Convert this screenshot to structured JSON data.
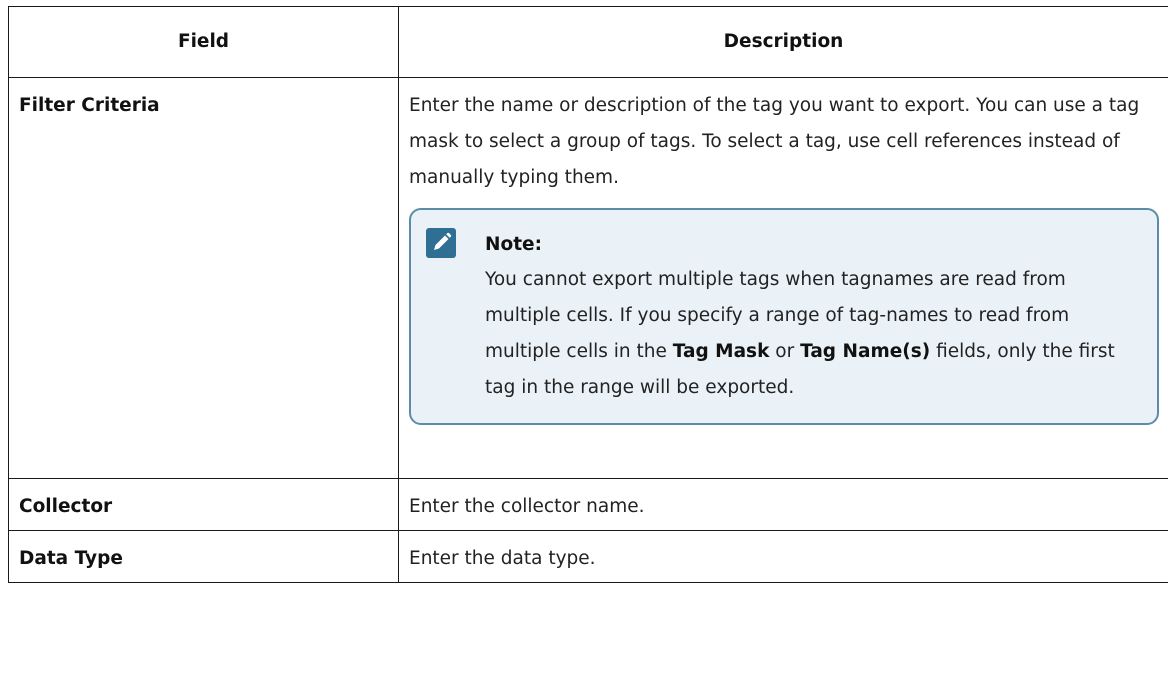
{
  "table": {
    "headers": {
      "field": "Field",
      "description": "Description"
    },
    "rows": [
      {
        "field": "Filter Criteria",
        "description": "Enter the name or description of the tag you want to export. You can use a tag mask to select a group of tags. To select a tag, use cell references instead of manually typing them.",
        "note": {
          "icon": "pencil-edit-icon",
          "title": "Note:",
          "text_1": "You cannot export multiple tags when tagnames are read from multiple cells. If you specify a range of tag-names to read from multiple cells in the ",
          "bold_1": "Tag Mask",
          "text_2": " or ",
          "bold_2": "Tag Name(s)",
          "text_3": " fields, only the first tag in the range will be exported."
        }
      },
      {
        "field": "Collector",
        "description": "Enter the collector name."
      },
      {
        "field": "Data Type",
        "description": "Enter the data type."
      }
    ]
  },
  "colors": {
    "note_border": "#5b8ca8",
    "note_background": "#eaf2f7",
    "note_icon": "#2e6f93",
    "table_border": "#1a1a1a"
  }
}
